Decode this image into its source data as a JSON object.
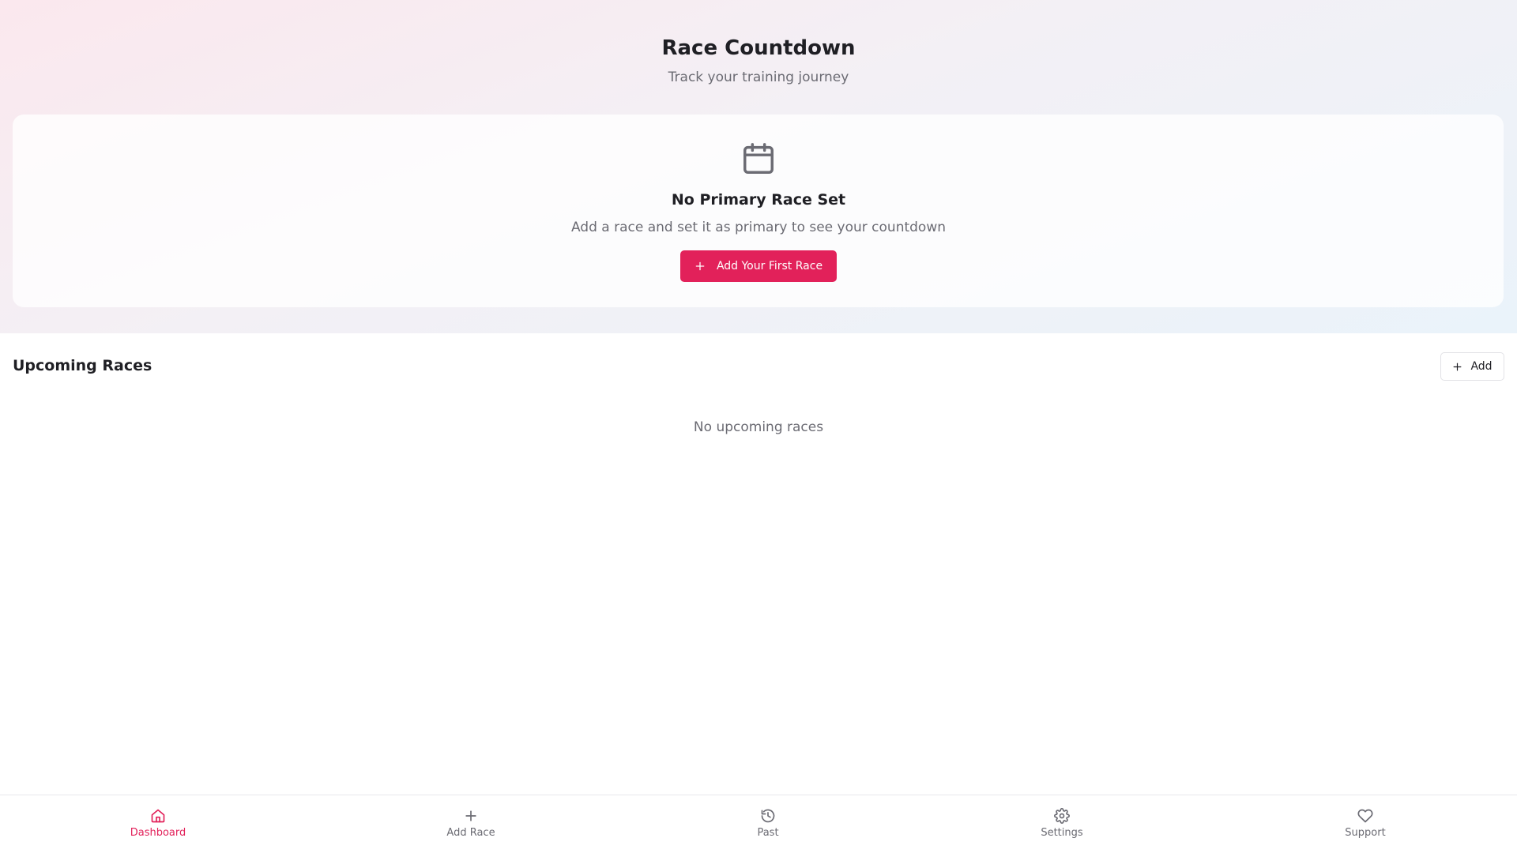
{
  "header": {
    "title": "Race Countdown",
    "subtitle": "Track your training journey"
  },
  "primary_race_card": {
    "icon": "calendar-icon",
    "title": "No Primary Race Set",
    "description": "Add a race and set it as primary to see your countdown",
    "button_label": "Add Your First Race"
  },
  "upcoming": {
    "title": "Upcoming Races",
    "add_label": "Add",
    "empty_text": "No upcoming races"
  },
  "bottom_nav": {
    "items": [
      {
        "label": "Dashboard",
        "icon": "home-icon",
        "active": true
      },
      {
        "label": "Add Race",
        "icon": "plus-icon",
        "active": false
      },
      {
        "label": "Past",
        "icon": "history-icon",
        "active": false
      },
      {
        "label": "Settings",
        "icon": "gear-icon",
        "active": false
      },
      {
        "label": "Support",
        "icon": "heart-icon",
        "active": false
      }
    ]
  },
  "colors": {
    "accent": "#e2215a",
    "muted_text": "#6b6b73",
    "heading_text": "#1f1f24"
  }
}
